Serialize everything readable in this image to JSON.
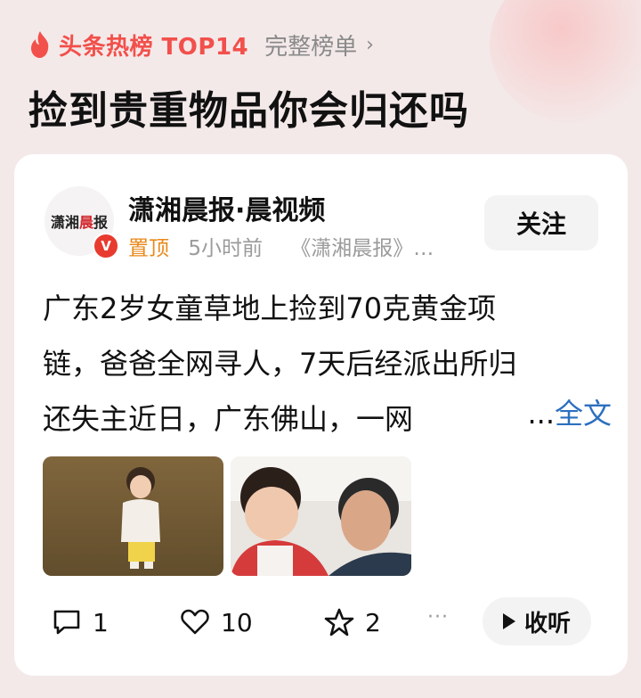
{
  "header": {
    "rank_label": "头条热榜 TOP14",
    "full_list_label": "完整榜单",
    "topic_title": "捡到贵重物品你会归还吗"
  },
  "post": {
    "avatar_text_1": "潇湘",
    "avatar_text_2": "晨",
    "avatar_text_3": "报",
    "verified_mark": "V",
    "author": "潇湘晨报·晨视频",
    "pinned": "置顶",
    "time": "5小时前",
    "source": "《潇湘晨报》…",
    "follow_label": "关注",
    "text_lines": [
      "广东2岁女童草地上捡到70克黄金项",
      "链，爸爸全网寻人，7天后经派出所归",
      "还失主近日，广东佛山，一网"
    ],
    "ellipsis": "...",
    "full_text_label": "全文",
    "images": [
      "child-on-grass-photo",
      "father-and-child-selfie-photo"
    ]
  },
  "actions": {
    "comments": "1",
    "likes": "10",
    "favorites": "2",
    "more_dots": "···",
    "listen_label": "收听"
  },
  "colors": {
    "brand_red": "#f2504b",
    "pinned_orange": "#e8891a",
    "link_blue": "#2c6fbf",
    "page_bg": "#f4e9e9"
  }
}
